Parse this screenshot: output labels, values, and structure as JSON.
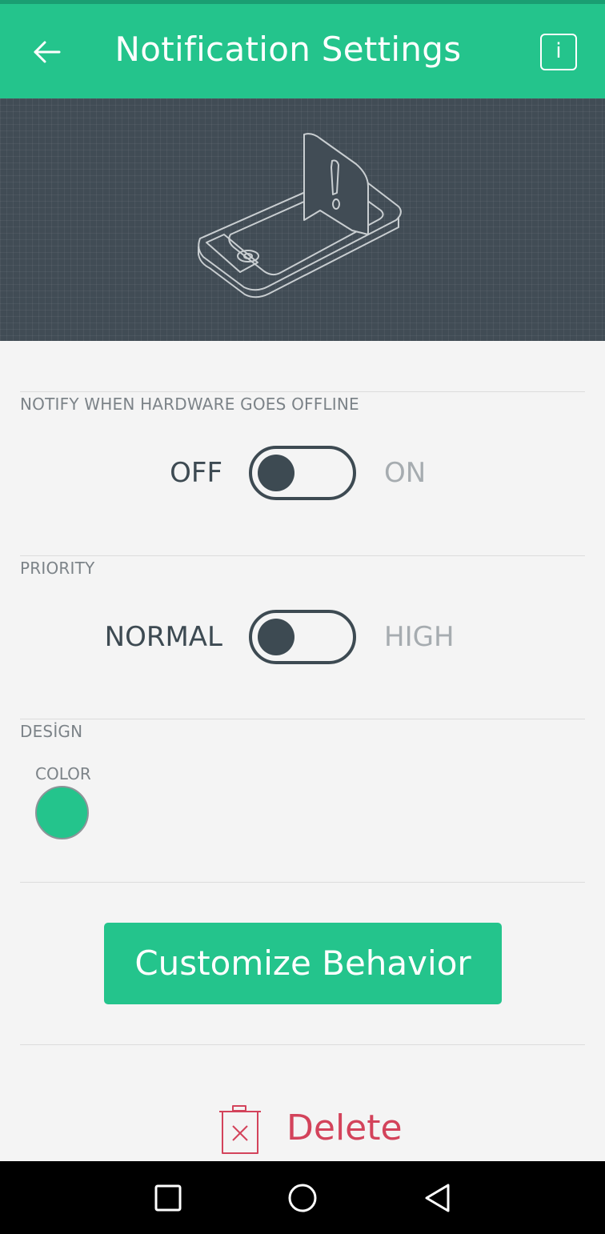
{
  "header": {
    "title": "Notification Settings",
    "back_icon": "arrow-left-icon",
    "info_label": "i"
  },
  "offline": {
    "section_label": "NOTIFY WHEN HARDWARE GOES OFFLINE",
    "off_label": "OFF",
    "on_label": "ON",
    "state": "off"
  },
  "priority": {
    "section_label": "PRIORITY",
    "normal_label": "NORMAL",
    "high_label": "HIGH",
    "state": "normal"
  },
  "design": {
    "section_label": "DESİGN",
    "color_label": "COLOR",
    "color_value": "#24c48c"
  },
  "actions": {
    "customize_label": "Customize Behavior",
    "delete_label": "Delete",
    "delete_icon": "trash-icon"
  },
  "colors": {
    "accent": "#24c48c",
    "dark": "#3d4a52",
    "danger": "#d3435b",
    "hero_bg": "#414c55"
  },
  "navbar": {
    "icons": [
      "recents-square-icon",
      "home-circle-icon",
      "back-triangle-icon"
    ]
  }
}
